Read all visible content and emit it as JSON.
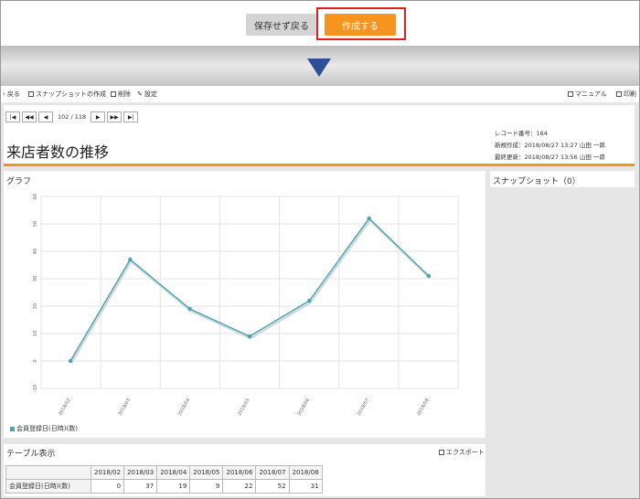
{
  "top_actions": {
    "back_label": "保存せず戻る",
    "create_label": "作成する",
    "highlight_color": "#e02020"
  },
  "toolbar": {
    "back": "戻る",
    "snapshot": "スナップショットの作成",
    "delete": "削除",
    "settings": "設定",
    "manual": "マニュアル",
    "print": "印刷"
  },
  "pager": {
    "first": "first-page-icon",
    "prev_fast": "rewind-icon",
    "prev": "prev-icon",
    "count": "102 / 118",
    "next": "next-icon",
    "next_fast": "fast-forward-icon",
    "last": "last-page-icon"
  },
  "record": {
    "number": "レコード番号：164",
    "created": "新規作成：2018/08/27 13:27 山田 一郎",
    "updated": "最終更新：2018/08/27 13:56 山田 一郎"
  },
  "page_title": "来店者数の推移",
  "graph_title": "グラフ",
  "snapshot_title": "スナップショット（0）",
  "table_title": "テーブル表示",
  "export_label": "エクスポート",
  "accent_color": "#f7941d",
  "series_color": "#4aa3b2",
  "chart_data": {
    "type": "line",
    "x": [
      "2018/02",
      "2018/03",
      "2018/04",
      "2018/05",
      "2018/06",
      "2018/07",
      "2018/08"
    ],
    "series": [
      {
        "name": "会員登録日(日時)(数)",
        "values": [
          0,
          37,
          19,
          9,
          22,
          52,
          31
        ]
      }
    ],
    "y_ticks": [
      "60",
      "50",
      "40",
      "30",
      "20",
      "10",
      "0",
      "-10"
    ],
    "ylim": [
      -10,
      60
    ],
    "grid": true,
    "legend": "bottom-left"
  },
  "table": {
    "row_label": "会員登録日(日時)(数)",
    "columns": [
      "2018/02",
      "2018/03",
      "2018/04",
      "2018/05",
      "2018/06",
      "2018/07",
      "2018/08"
    ],
    "values": [
      "0",
      "37",
      "19",
      "9",
      "22",
      "52",
      "31"
    ]
  }
}
